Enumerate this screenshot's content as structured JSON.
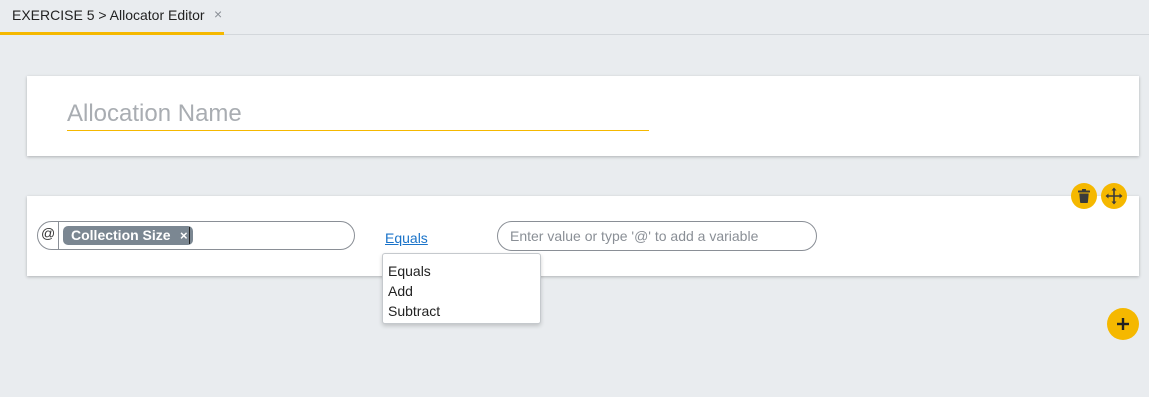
{
  "tab": {
    "title": "EXERCISE 5 > Allocator Editor",
    "close_icon": "×"
  },
  "allocation": {
    "name_placeholder": "Allocation Name",
    "name_value": ""
  },
  "rule": {
    "variable_prefix": "@",
    "variable_chip": "Collection Size",
    "chip_remove_icon": "×",
    "operator": "Equals",
    "value_placeholder": "Enter value or type '@' to add a variable",
    "value": ""
  },
  "operator_menu": {
    "options": [
      "Equals",
      "Add",
      "Subtract"
    ]
  },
  "icons": {
    "delete": "trash-icon",
    "move": "move-icon",
    "add": "plus-icon"
  },
  "colors": {
    "accent": "#f5b800",
    "link": "#1a73c9",
    "chip": "#7b8792",
    "background": "#e9ecef"
  }
}
